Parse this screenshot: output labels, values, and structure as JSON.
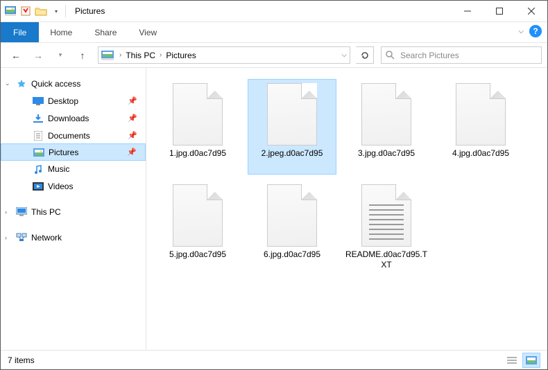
{
  "window": {
    "title": "Pictures"
  },
  "ribbon": {
    "file": "File",
    "tabs": [
      "Home",
      "Share",
      "View"
    ]
  },
  "breadcrumb": {
    "items": [
      "This PC",
      "Pictures"
    ]
  },
  "search": {
    "placeholder": "Search Pictures"
  },
  "sidebar": {
    "quick": "Quick access",
    "items": [
      {
        "label": "Desktop",
        "pinned": true
      },
      {
        "label": "Downloads",
        "pinned": true
      },
      {
        "label": "Documents",
        "pinned": true
      },
      {
        "label": "Pictures",
        "pinned": true,
        "selected": true
      },
      {
        "label": "Music",
        "pinned": false
      },
      {
        "label": "Videos",
        "pinned": false
      }
    ],
    "this_pc": "This PC",
    "network": "Network"
  },
  "files": [
    {
      "name": "1.jpg.d0ac7d95",
      "type": "blank"
    },
    {
      "name": "2.jpeg.d0ac7d95",
      "type": "blank",
      "selected": true
    },
    {
      "name": "3.jpg.d0ac7d95",
      "type": "blank"
    },
    {
      "name": "4.jpg.d0ac7d95",
      "type": "blank"
    },
    {
      "name": "5.jpg.d0ac7d95",
      "type": "blank"
    },
    {
      "name": "6.jpg.d0ac7d95",
      "type": "blank"
    },
    {
      "name": "README.d0ac7d95.TXT",
      "type": "txt"
    }
  ],
  "status": {
    "count": "7 items"
  }
}
